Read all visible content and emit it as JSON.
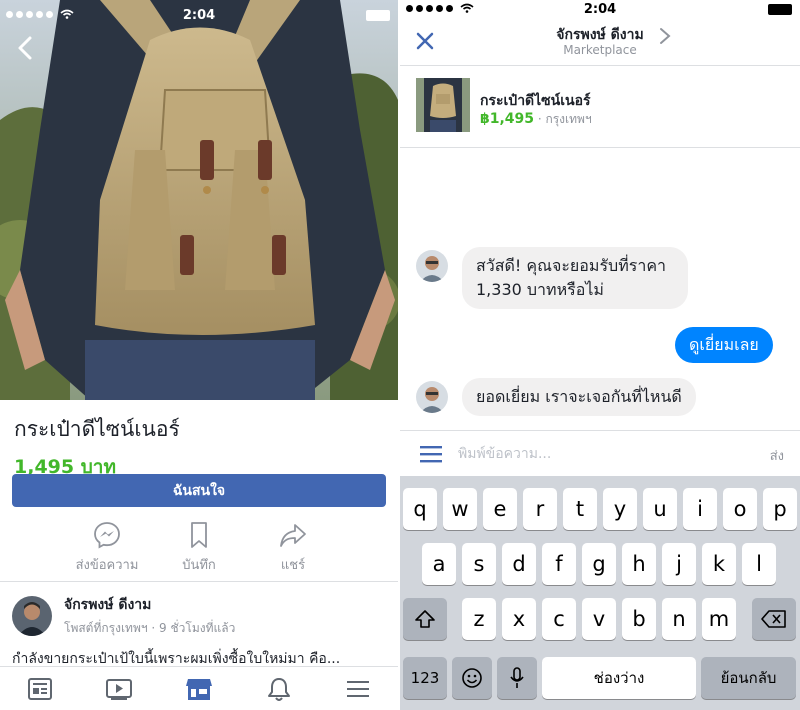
{
  "status_bar": {
    "time": "2:04"
  },
  "product": {
    "title": "กระเป๋าดีไซน์เนอร์",
    "price": "1,495 บาท",
    "cta_label": "ฉันสนใจ",
    "actions": [
      {
        "label": "ส่งข้อความ",
        "icon": "messenger-icon"
      },
      {
        "label": "บันทึก",
        "icon": "bookmark-icon"
      },
      {
        "label": "แชร์",
        "icon": "share-icon"
      }
    ]
  },
  "seller": {
    "name": "จักรพงษ์ ดีงาม",
    "meta": "โพสต์ที่กรุงเทพฯ · 9 ชั่วโมงที่แล้ว"
  },
  "description": "กำลังขายกระเป๋าเป้ใบนี้เพราะผมเพิ่งซื้อใบใหม่มา คือ...",
  "tabbar": [
    "news-feed-icon",
    "watch-icon",
    "marketplace-icon",
    "notifications-icon",
    "menu-icon"
  ],
  "chat": {
    "name": "จักรพงษ์ ดีงาม",
    "subtitle": "Marketplace",
    "listing_title": "กระเป๋าดีไซน์เนอร์",
    "listing_price": "฿1,495",
    "listing_location": " · กรุงเทพฯ",
    "messages": [
      {
        "from": "seller",
        "line1": "สวัสดี! คุณจะยอมรับที่ราคา",
        "line2": "1,330 บาทหรือไม่"
      },
      {
        "from": "me",
        "text": "ดูเยี่ยมเลย"
      },
      {
        "from": "seller",
        "text": "ยอดเยี่ยม เราจะเจอกันที่ไหนดี"
      }
    ],
    "composer_placeholder": "พิมพ์ข้อความ...",
    "send_label": "ส่ง"
  },
  "keyboard": {
    "row1": [
      "q",
      "w",
      "e",
      "r",
      "t",
      "y",
      "u",
      "i",
      "o",
      "p"
    ],
    "row2": [
      "a",
      "s",
      "d",
      "f",
      "g",
      "h",
      "j",
      "k",
      "l"
    ],
    "row3": [
      "z",
      "x",
      "c",
      "v",
      "b",
      "n",
      "m"
    ],
    "numbers": "123",
    "space": "ช่องว่าง",
    "return": "ย้อนกลับ"
  },
  "colors": {
    "brand": "#4267b2",
    "price": "#42b72a",
    "bubble_me": "#0084ff",
    "bubble_them": "#f1f0f0"
  }
}
